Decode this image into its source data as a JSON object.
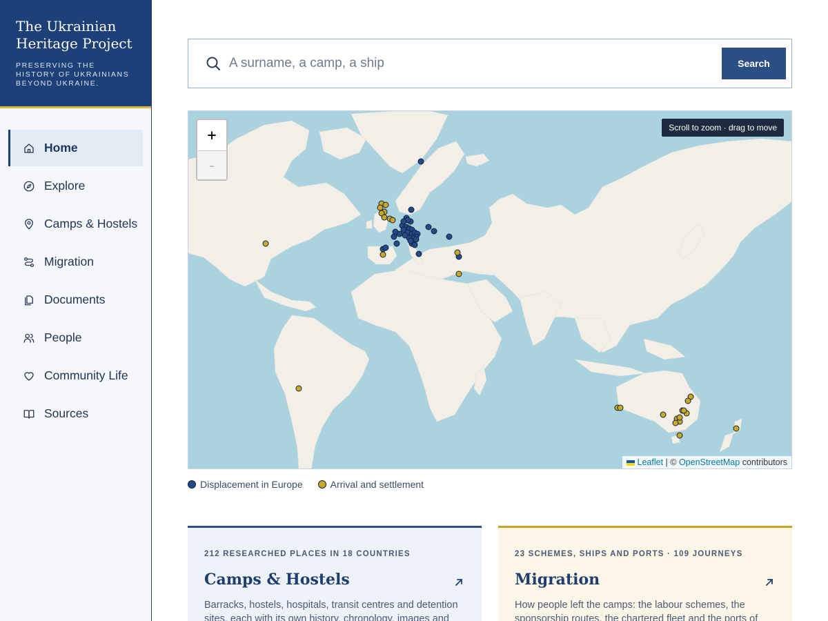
{
  "brand": {
    "title": "The Ukrainian Heritage Project",
    "subtitle": "PRESERVING THE HISTORY OF UKRAINIANS BEYOND UKRAINE."
  },
  "nav": [
    {
      "label": "Home",
      "icon": "home-icon",
      "active": true
    },
    {
      "label": "Explore",
      "icon": "compass-icon",
      "active": false
    },
    {
      "label": "Camps & Hostels",
      "icon": "map-pin-icon",
      "active": false
    },
    {
      "label": "Migration",
      "icon": "route-icon",
      "active": false
    },
    {
      "label": "Documents",
      "icon": "documents-icon",
      "active": false
    },
    {
      "label": "People",
      "icon": "people-icon",
      "active": false
    },
    {
      "label": "Community Life",
      "icon": "heart-icon",
      "active": false
    },
    {
      "label": "Sources",
      "icon": "book-icon",
      "active": false
    }
  ],
  "search": {
    "placeholder": "A surname, a camp, a ship",
    "value": "",
    "button_label": "Search"
  },
  "map": {
    "zoom_in_label": "+",
    "zoom_out_label": "-",
    "hint": "Scroll to zoom · drag to move",
    "attribution": {
      "leaflet": "Leaflet",
      "separator": "| ©",
      "osm": "OpenStreetMap",
      "suffix": "contributors"
    },
    "colors": {
      "water": "#aad3df",
      "land": "#f2efe9",
      "displacement": "#244a8a",
      "arrival": "#c9a826"
    }
  },
  "legend": [
    {
      "label": "Displacement in Europe",
      "color": "#244a8a"
    },
    {
      "label": "Arrival and settlement",
      "color": "#c9a826"
    }
  ],
  "cards": [
    {
      "kicker": "212 RESEARCHED PLACES IN 18 COUNTRIES",
      "title": "Camps & Hostels",
      "text": "Barracks, hostels, hospitals, transit centres and detention sites, each with its own history, chronology, images and"
    },
    {
      "kicker": "23 SCHEMES, SHIPS AND PORTS · 109 JOURNEYS",
      "title": "Migration",
      "text": "How people left the camps: the labour schemes, the sponsorship routes, the chartered fleet and the ports of"
    }
  ]
}
